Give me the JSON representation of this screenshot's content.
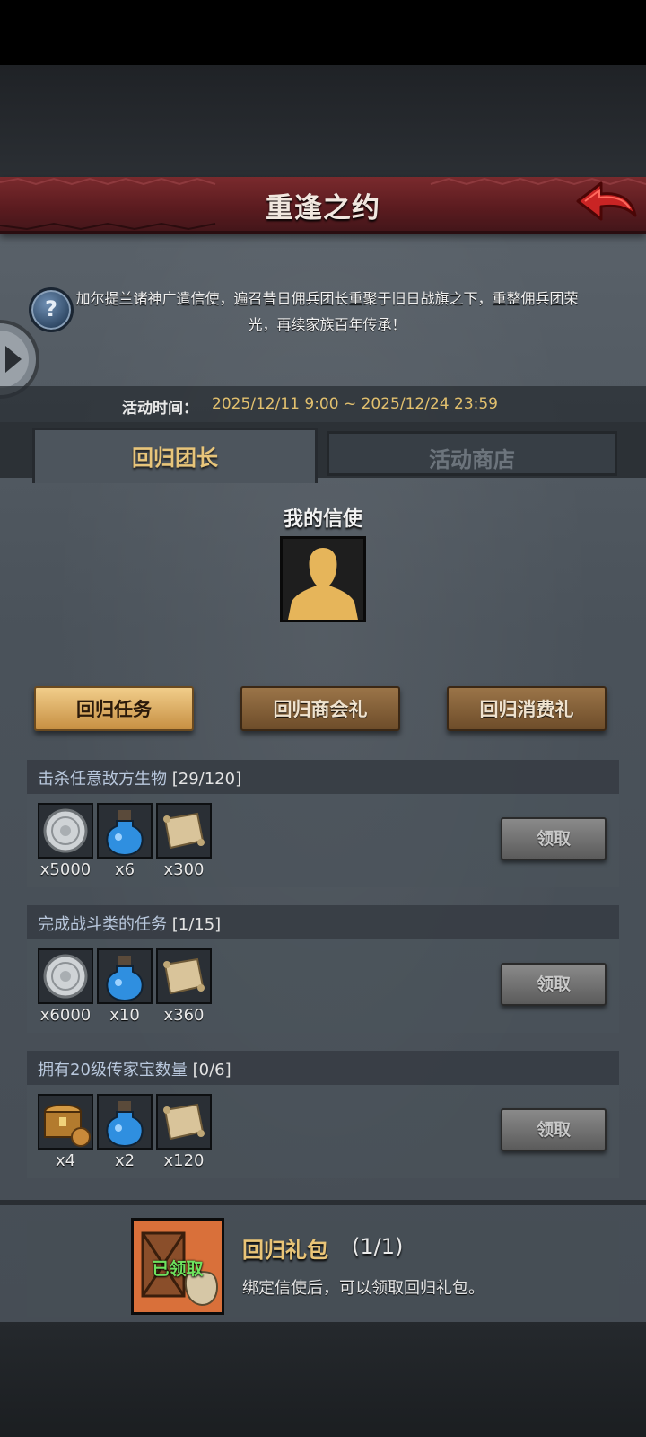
{
  "header": {
    "title": "重逢之约",
    "back_icon": "back-arrow-icon"
  },
  "description": "加尔提兰诸神广遣信使，遍召昔日佣兵团长重聚于旧日战旗之下，重整佣兵团荣光，再续家族百年传承！",
  "activity_time": {
    "label": "活动时间：",
    "value": "2025/12/11 9:00 ~ 2025/12/24 23:59"
  },
  "tabs": [
    {
      "label": "回归团长",
      "active": true
    },
    {
      "label": "活动商店",
      "active": false
    }
  ],
  "messenger": {
    "title": "我的信使",
    "avatar_icon": "silhouette-icon"
  },
  "sub_tabs": [
    {
      "label": "回归任务",
      "active": true
    },
    {
      "label": "回归商会礼",
      "active": false
    },
    {
      "label": "回归消费礼",
      "active": false
    }
  ],
  "tasks": [
    {
      "title": "击杀任意敌方生物",
      "progress": "[29/120]",
      "rewards": [
        {
          "icon": "silver-coin-icon",
          "qty": "x5000"
        },
        {
          "icon": "blue-potion-icon",
          "qty": "x6"
        },
        {
          "icon": "scroll-icon",
          "qty": "x300"
        }
      ],
      "claim_label": "领取"
    },
    {
      "title": "完成战斗类的任务",
      "progress": "[1/15]",
      "rewards": [
        {
          "icon": "silver-coin-icon",
          "qty": "x6000"
        },
        {
          "icon": "blue-potion-icon",
          "qty": "x10"
        },
        {
          "icon": "scroll-icon",
          "qty": "x360"
        }
      ],
      "claim_label": "领取"
    },
    {
      "title": "拥有20级传家宝数量",
      "progress": "[0/6]",
      "rewards": [
        {
          "icon": "treasure-chest-icon",
          "qty": "x4"
        },
        {
          "icon": "blue-potion-icon",
          "qty": "x2"
        },
        {
          "icon": "scroll-icon",
          "qty": "x120"
        }
      ],
      "claim_label": "领取"
    }
  ],
  "gift_pack": {
    "title": "回归礼包",
    "count": "(1/1)",
    "status": "已领取",
    "description": "绑定信使后，可以领取回归礼包。",
    "icon": "crate-and-sack-icon"
  },
  "colors": {
    "banner": "#6a2226",
    "accent_gold": "#e9c477",
    "time_value": "#e2c06e",
    "claimed_green": "#6ee25e",
    "task_title": "#b9c8dd"
  }
}
